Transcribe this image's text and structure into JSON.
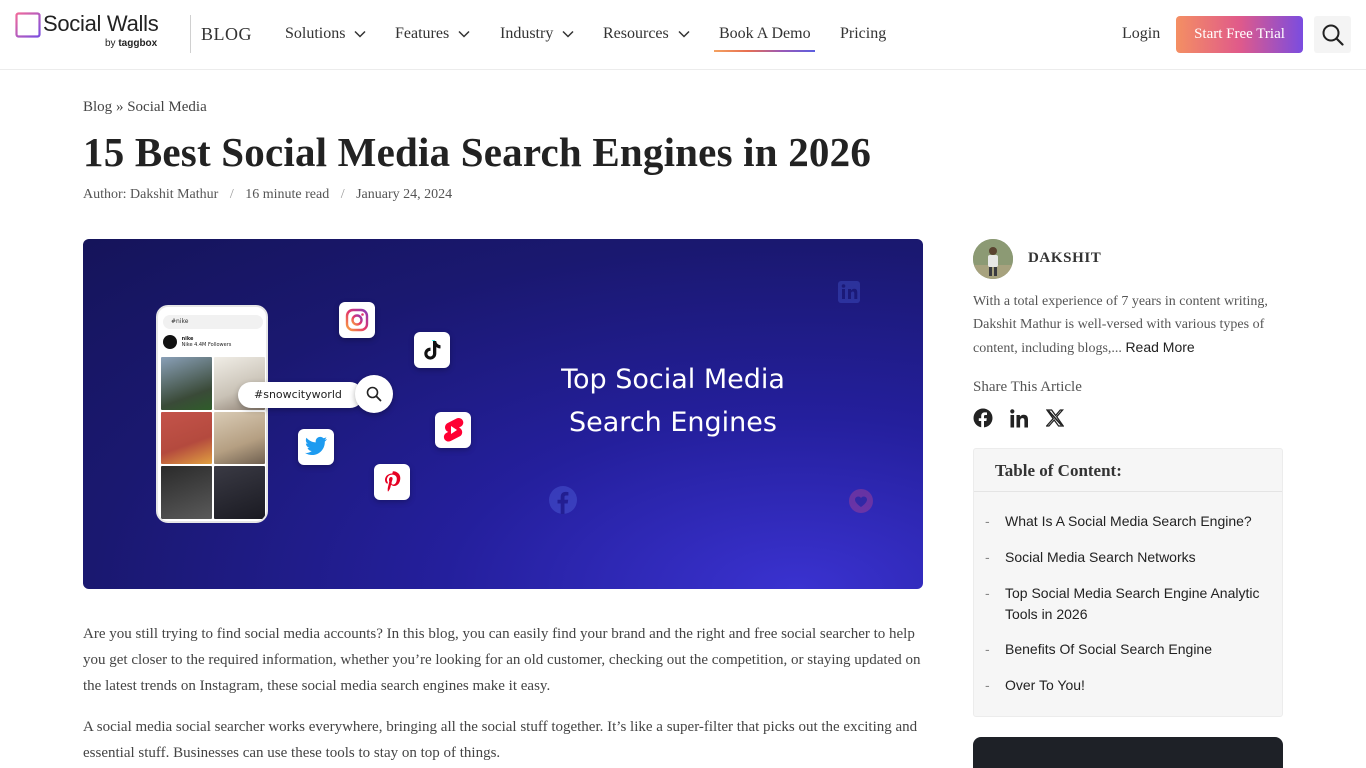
{
  "header": {
    "logo_text": "Social Walls",
    "logo_sub_by": "by",
    "logo_sub_brand": "taggbox",
    "blog_label": "BLOG",
    "nav": [
      {
        "label": "Solutions"
      },
      {
        "label": "Features"
      },
      {
        "label": "Industry"
      },
      {
        "label": "Resources"
      },
      {
        "label": "Book A Demo"
      },
      {
        "label": "Pricing"
      }
    ],
    "login_label": "Login",
    "trial_label": "Start Free Trial"
  },
  "breadcrumb": {
    "home": "Blog",
    "separator": "»",
    "current": "Social Media"
  },
  "article": {
    "title": "15 Best Social Media Search Engines in 2026",
    "author": "Author: Dakshit Mathur",
    "read_time": "16 minute read",
    "date": "January 24, 2024",
    "separator": "/",
    "paragraphs": [
      "Are you still trying to find social media accounts? In this blog, you can easily find your brand and the right and free social searcher to help you get closer to the required information, whether you’re looking for an old customer, checking out the competition, or staying updated on the latest trends on Instagram, these social media search engines make it easy.",
      "A social media social searcher works everywhere, bringing all the social stuff together. It’s like a super-filter that picks out the exciting and essential stuff. Businesses can use these tools to stay on top of things."
    ]
  },
  "hero": {
    "headline_line1": "Top Social Media",
    "headline_line2": "Search Engines",
    "hashtag": "#snowcityworld",
    "phone_search": "#nike",
    "phone_account": "nike",
    "phone_stats": "Nike  4.4M Followers",
    "colors": {
      "bg_dark": "#15145a",
      "bg_light": "#3a32d0"
    }
  },
  "sidebar": {
    "author_name": "DAKSHIT",
    "author_bio": "With a total experience of 7 years in content writing, Dakshit Mathur is well-versed with various types of content, including blogs,...",
    "read_more": "Read More",
    "share_label": "Share This Article",
    "share_icons": [
      "facebook-icon",
      "linkedin-icon",
      "x-icon"
    ],
    "toc_title": "Table of Content:",
    "toc_bullet": "-",
    "toc_items": [
      "What Is A Social Media Search Engine?",
      "Social Media Search Networks",
      "Top Social Media Search Engine Analytic Tools in 2026",
      "Benefits Of Social Search Engine",
      "Over To You!"
    ]
  },
  "colors": {
    "trial_gradient_start": "#f48f63",
    "trial_gradient_end": "#7a4ce0",
    "text_dark": "#222222",
    "toc_bg": "#f6f6f6"
  }
}
